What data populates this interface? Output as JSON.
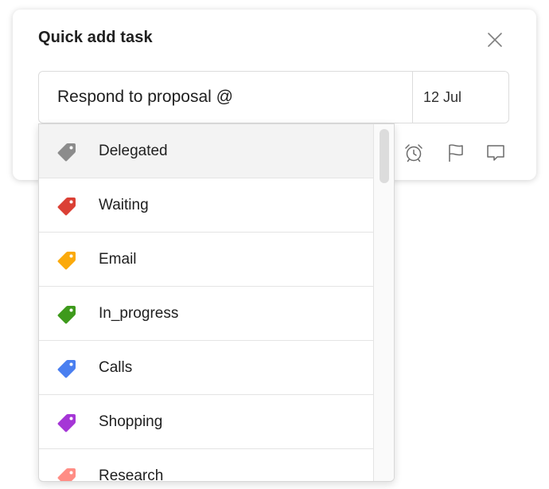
{
  "dialog": {
    "title": "Quick add task",
    "task_text": "Respond to proposal @",
    "due_date": "12 Jul"
  },
  "toolbar": {
    "icons": [
      "alarm-clock-icon",
      "flag-icon",
      "comment-icon"
    ]
  },
  "labels": [
    {
      "name": "Delegated",
      "color": "#8c8c8c",
      "selected": true
    },
    {
      "name": "Waiting",
      "color": "#db4035"
    },
    {
      "name": "Email",
      "color": "#fbaa0c"
    },
    {
      "name": "In_progress",
      "color": "#3e9a1c"
    },
    {
      "name": "Calls",
      "color": "#4a7ff0"
    },
    {
      "name": "Shopping",
      "color": "#a536d6"
    },
    {
      "name": "Research",
      "color": "#ff8d85"
    }
  ]
}
